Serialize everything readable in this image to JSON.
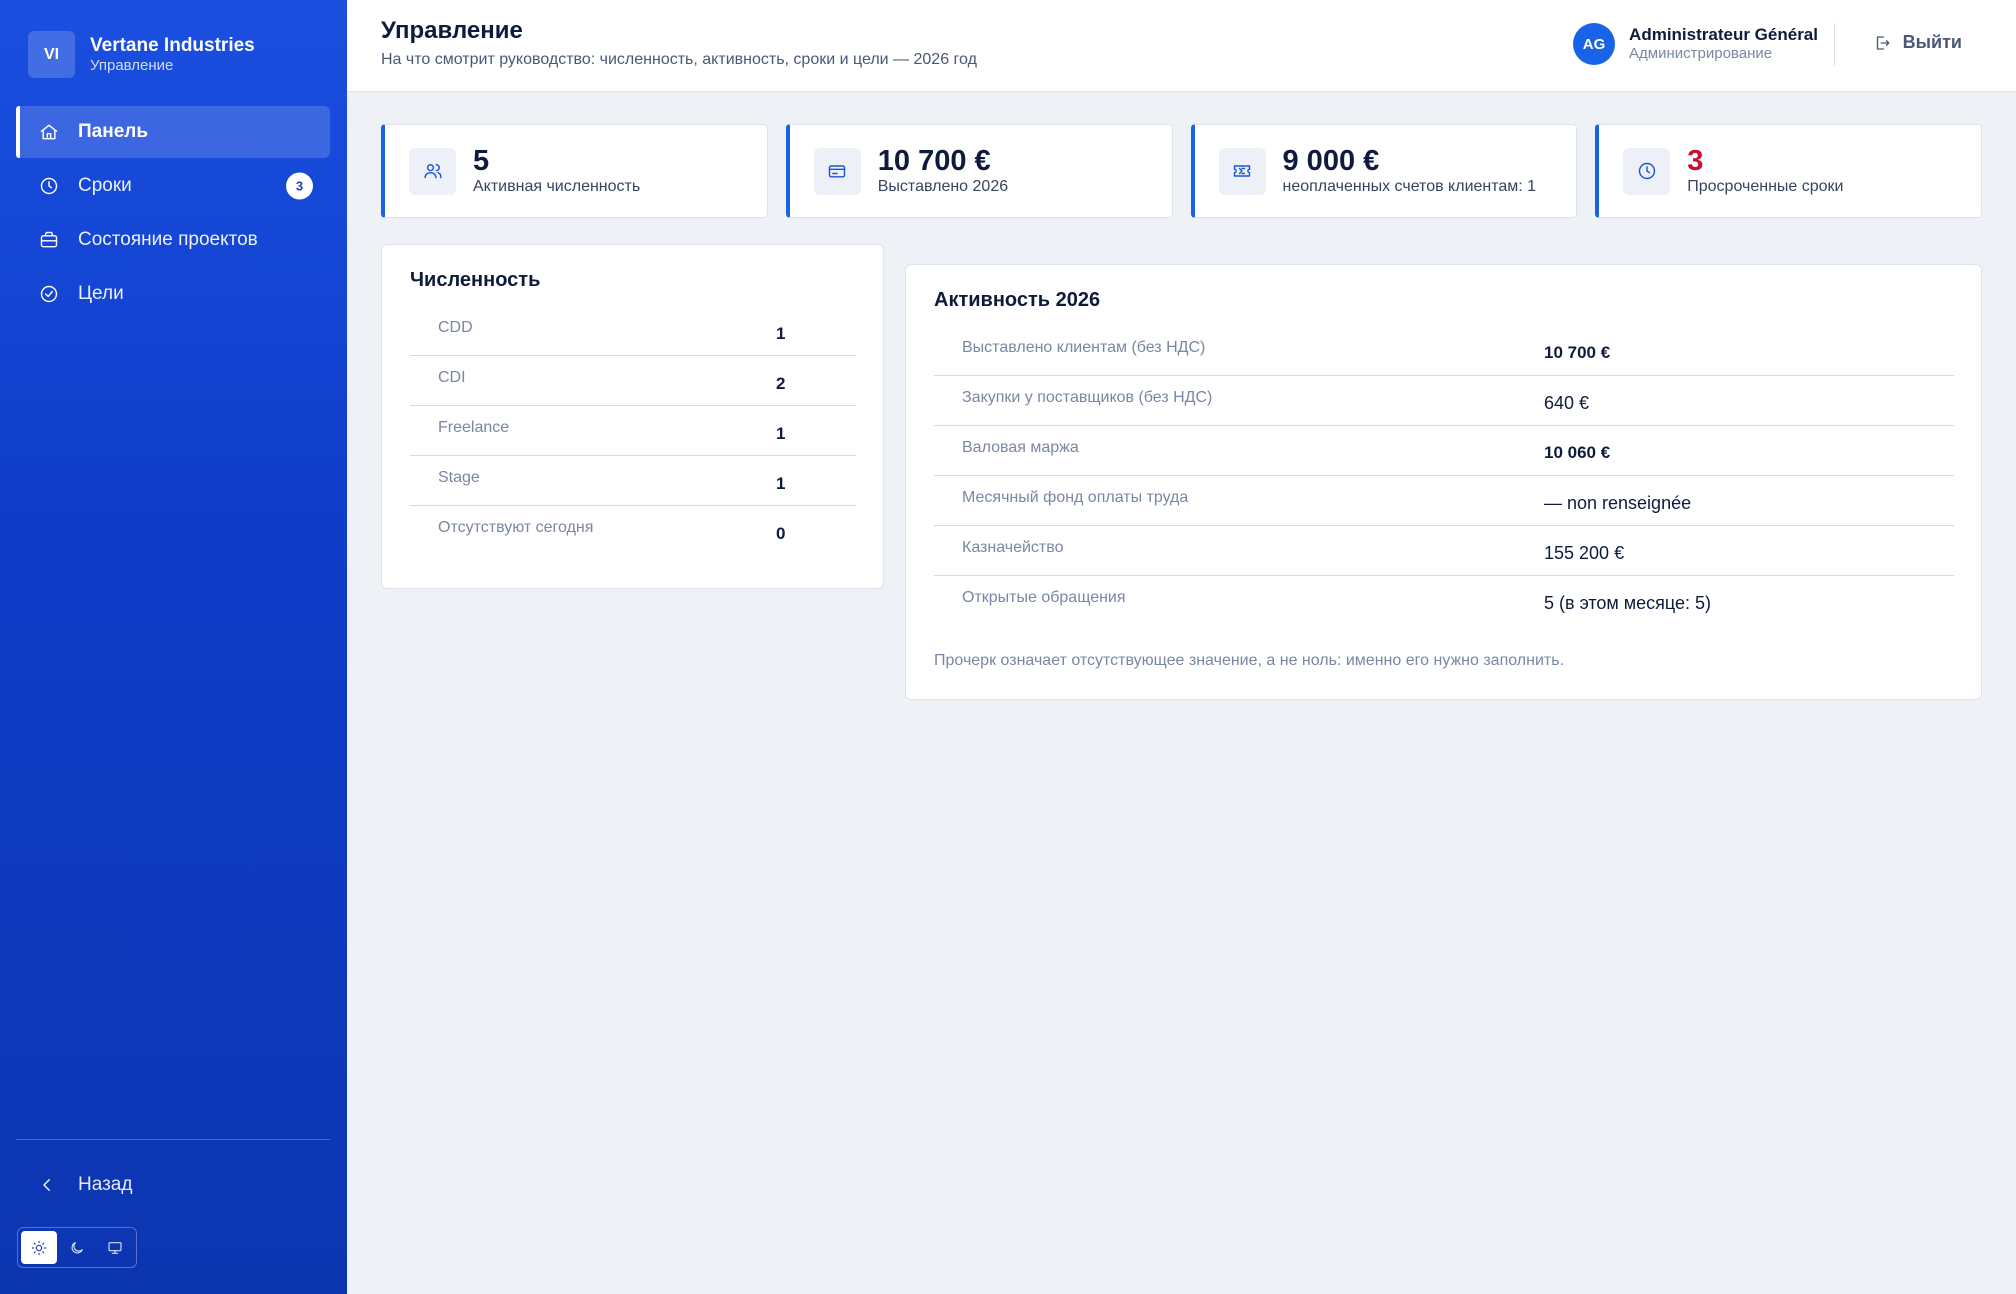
{
  "brand": {
    "initials": "VI",
    "name": "Vertane Industries",
    "subtitle": "Управление"
  },
  "sidebar": {
    "items": [
      {
        "label": "Панель",
        "icon": "home-icon",
        "active": true
      },
      {
        "label": "Сроки",
        "icon": "clock-icon",
        "badge": "3"
      },
      {
        "label": "Состояние проектов",
        "icon": "briefcase-icon"
      },
      {
        "label": "Цели",
        "icon": "check-circle-icon"
      }
    ],
    "back_label": "Назад",
    "theme_modes": [
      "light",
      "dark",
      "system"
    ],
    "theme_active": "light"
  },
  "header": {
    "title": "Управление",
    "subtitle": "На что смотрит руководство: численность, активность, сроки и цели — 2026 год",
    "user": {
      "initials": "AG",
      "name": "Administrateur Général",
      "role": "Администрирование"
    },
    "logout_label": "Выйти"
  },
  "kpis": [
    {
      "icon": "users-icon",
      "value": "5",
      "label": "Активная численность"
    },
    {
      "icon": "invoice-icon",
      "value": "10 700 €",
      "label": "Выставлено 2026"
    },
    {
      "icon": "ticket-icon",
      "value": "9 000 €",
      "label": "неоплаченных счетов клиентам: 1"
    },
    {
      "icon": "clock-icon",
      "value": "3",
      "label": "Просроченные сроки",
      "status": "danger"
    }
  ],
  "headcount": {
    "title": "Численность",
    "rows": [
      {
        "label": "CDD",
        "value": "1"
      },
      {
        "label": "CDI",
        "value": "2"
      },
      {
        "label": "Freelance",
        "value": "1"
      },
      {
        "label": "Stage",
        "value": "1"
      },
      {
        "label": "Отсутствуют сегодня",
        "value": "0"
      }
    ]
  },
  "activity": {
    "title": "Активность 2026",
    "rows": [
      {
        "label": "Выставлено клиентам (без НДС)",
        "value": "10 700 €"
      },
      {
        "label": "Закупки у поставщиков (без НДС)",
        "value": "640 €"
      },
      {
        "label": "Валовая маржа",
        "value": "10 060 €"
      },
      {
        "label": "Месячный фонд оплаты труда",
        "value": "— non renseignée"
      },
      {
        "label": "Казначейство",
        "value": "155 200 €"
      },
      {
        "label": "Открытые обращения",
        "value": "5 (в этом месяце: 5)"
      }
    ],
    "note": "Прочерк означает отсутствующее значение, а не ноль: именно его нужно заполнить."
  },
  "colors": {
    "accent": "#1863e8",
    "sidebar": "#1a4fe0",
    "danger": "#c8102e",
    "background": "#eef1f5"
  }
}
